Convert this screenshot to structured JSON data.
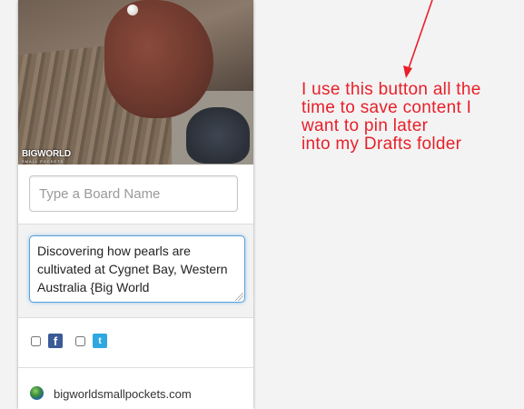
{
  "board_field": {
    "placeholder": "Type a Board Name"
  },
  "description_field": {
    "value": "Discovering how pearls are cultivated at Cygnet Bay, Western Australia {Big World"
  },
  "share": {
    "facebook_glyph": "f",
    "twitter_glyph": "t"
  },
  "source": {
    "domain": "bigworldsmallpockets.com"
  },
  "photo_logo": {
    "line1": "BIGWORLD",
    "line2": "SMALL POCKETS"
  },
  "annotation": {
    "lines": [
      "I use this button all the",
      "time to save content I",
      "want to pin later",
      "into my Drafts folder"
    ],
    "color": "#e8202a"
  }
}
